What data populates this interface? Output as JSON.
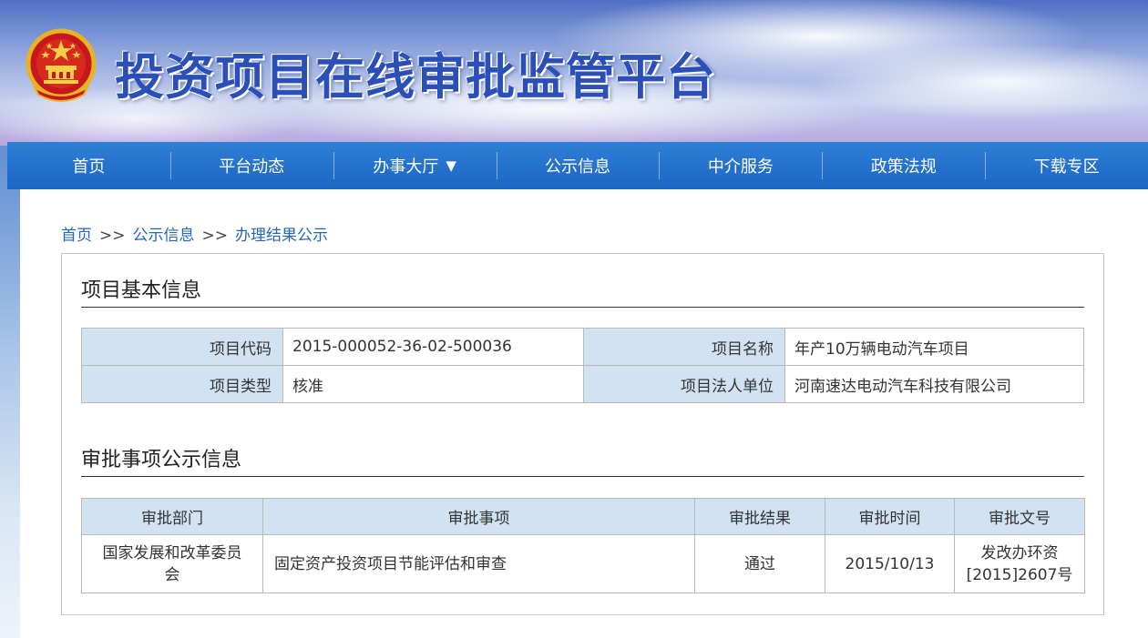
{
  "site": {
    "title": "投资项目在线审批监管平台"
  },
  "nav": {
    "items": [
      {
        "label": "首页",
        "id": "home"
      },
      {
        "label": "平台动态",
        "id": "news"
      },
      {
        "label": "办事大厅",
        "id": "hall",
        "dropdown_arrow": "▼"
      },
      {
        "label": "公示信息",
        "id": "publicity"
      },
      {
        "label": "中介服务",
        "id": "agency"
      },
      {
        "label": "政策法规",
        "id": "policy"
      },
      {
        "label": "下载专区",
        "id": "download"
      }
    ]
  },
  "breadcrumb": {
    "items": [
      "首页",
      "公示信息",
      "办理结果公示"
    ],
    "separator": ">>"
  },
  "project_info": {
    "section_title": "项目基本信息",
    "rows": [
      {
        "label1": "项目代码",
        "value1": "2015-000052-36-02-500036",
        "label2": "项目名称",
        "value2": "年产10万辆电动汽车项目"
      },
      {
        "label1": "项目类型",
        "value1": "核准",
        "label2": "项目法人单位",
        "value2": "河南速达电动汽车科技有限公司"
      }
    ]
  },
  "approval": {
    "section_title": "审批事项公示信息",
    "columns": [
      "审批部门",
      "审批事项",
      "审批结果",
      "审批时间",
      "审批文号"
    ],
    "rows": [
      {
        "department_line1": "国家发展和改革委员",
        "department_line2": "会",
        "item": "固定资产投资项目节能评估和审查",
        "result": "通过",
        "date": "2015/10/13",
        "doc_line1": "发改办环资",
        "doc_line2": "[2015]2607号"
      }
    ]
  },
  "colors": {
    "nav_bg": "#1c66c4",
    "title_blue": "#2a4fb8",
    "label_cell_bg": "#d1e3f2",
    "link_blue": "#2566b6"
  },
  "icons": {
    "emblem": "national-emblem-icon"
  }
}
